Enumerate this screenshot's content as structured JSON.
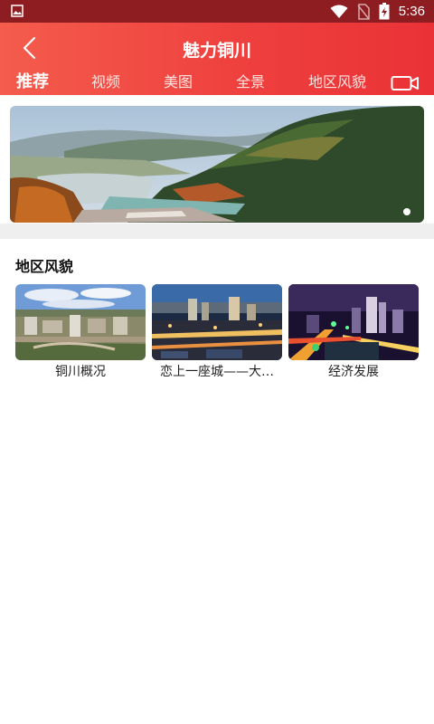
{
  "status_bar": {
    "time": "5:36",
    "icons": [
      "image-icon",
      "wifi-icon",
      "no-sim-icon",
      "battery-icon"
    ]
  },
  "header": {
    "title": "魅力铜川",
    "tabs": [
      {
        "label": "推荐",
        "active": true
      },
      {
        "label": "视频",
        "active": false
      },
      {
        "label": "美图",
        "active": false
      },
      {
        "label": "全景",
        "active": false
      },
      {
        "label": "地区风貌",
        "active": false
      }
    ]
  },
  "banner": {
    "page_count": 1,
    "current_page": 1
  },
  "section": {
    "title": "地区风貌",
    "cards": [
      {
        "caption": "铜川概况"
      },
      {
        "caption": "恋上一座城——大…"
      },
      {
        "caption": "经济发展"
      }
    ]
  },
  "colors": {
    "header_start": "#f45c4c",
    "header_end": "#ea3236",
    "status_bar": "#8e1d22"
  }
}
